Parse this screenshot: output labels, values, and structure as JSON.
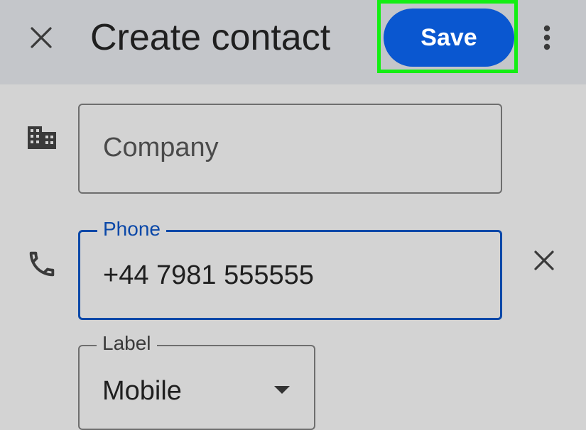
{
  "header": {
    "title": "Create contact",
    "save_label": "Save",
    "close_icon": "close-icon",
    "more_icon": "more-vert-icon",
    "save_color": "#0a57d0",
    "highlight_color": "#13ee13"
  },
  "company_field": {
    "icon": "building-icon",
    "placeholder": "Company"
  },
  "phone_field": {
    "icon": "phone-icon",
    "legend": "Phone",
    "value": "+44 7981 555555",
    "clear_icon": "clear-icon"
  },
  "label_field": {
    "legend": "Label",
    "value": "Mobile"
  }
}
